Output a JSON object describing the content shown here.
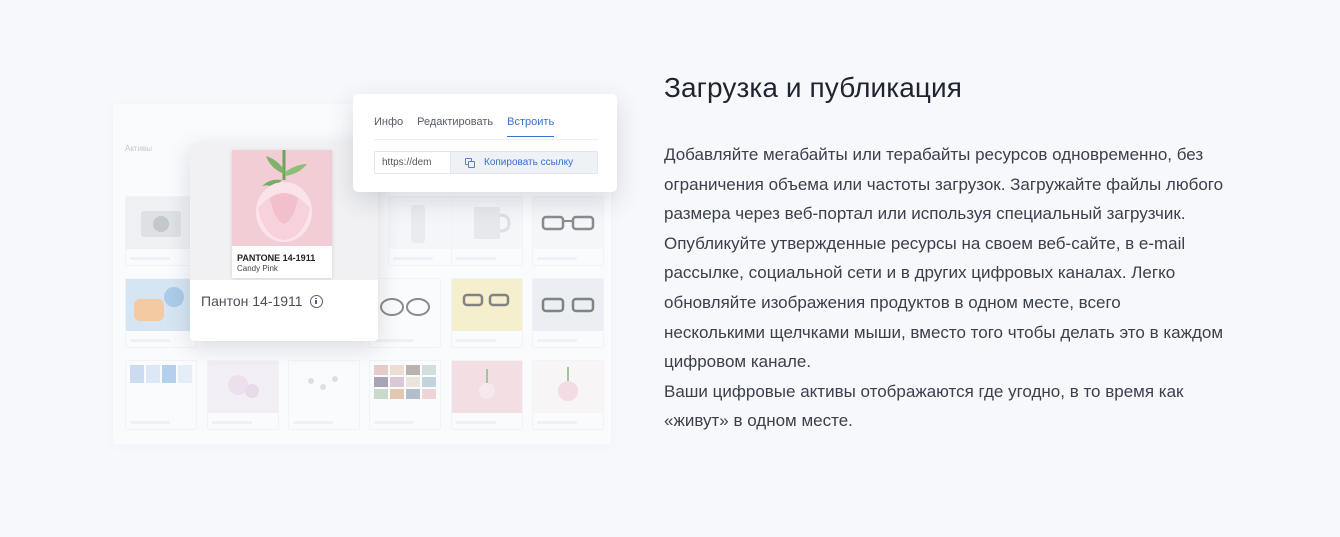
{
  "illustration": {
    "assets_title": "Активы",
    "asset_card": {
      "pantone_code": "PANTONE 14-1911",
      "pantone_name": "Candy Pink",
      "caption": "Пантон 14-1911"
    },
    "share_popup": {
      "tabs": [
        {
          "label": "Инфо",
          "active": false
        },
        {
          "label": "Редактировать",
          "active": false
        },
        {
          "label": "Встроить",
          "active": true
        }
      ],
      "url_value": "https://dem",
      "copy_button_label": "Копировать ссылку"
    },
    "tiles": [
      "glasses-icon",
      "mug",
      "rose",
      "palette"
    ]
  },
  "content": {
    "heading": "Загрузка и публикация",
    "paragraphs": [
      "Добавляйте мегабайты или терабайты ресурсов одновременно, без ограничения объема или частоты загрузок. Загружайте файлы любого размера через веб-портал или используя специальный загрузчик.",
      "Опубликуйте утвержденные ресурсы на своем веб-сайте, в e-mail рассылке, социальной сети и в других цифровых каналах. Легко обновляйте изображения продуктов в одном месте, всего несколькими щелчками мыши, вместо того чтобы делать это в каждом цифровом канале.",
      "Ваши цифровые активы отображаются где угодно, в то время как «живут» в одном месте."
    ]
  },
  "colors": {
    "accent": "#3a70c9",
    "background": "#f6f8fc",
    "candy_pink": "#f2cdd6"
  }
}
